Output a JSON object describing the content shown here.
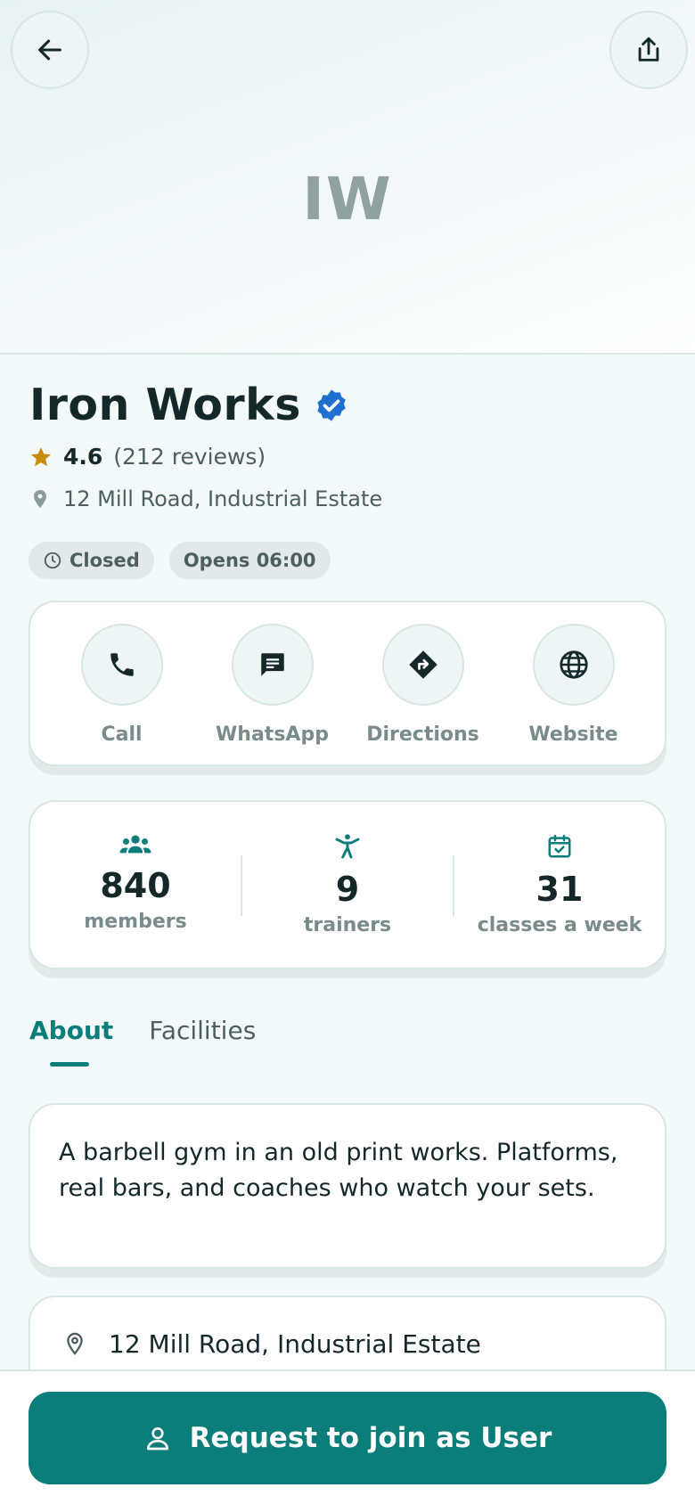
{
  "hero": {
    "initials": "IW"
  },
  "gym": {
    "name": "Iron Works",
    "rating": "4.6",
    "reviews": "(212 reviews)",
    "address": "12 Mill Road, Industrial Estate",
    "status": "Closed",
    "opens": "Opens 06:00"
  },
  "actions": [
    {
      "label": "Call",
      "icon": "phone-icon"
    },
    {
      "label": "WhatsApp",
      "icon": "message-icon"
    },
    {
      "label": "Directions",
      "icon": "directions-icon"
    },
    {
      "label": "Website",
      "icon": "globe-icon"
    }
  ],
  "stats": [
    {
      "value": "840",
      "label": "members",
      "icon": "group-icon"
    },
    {
      "value": "9",
      "label": "trainers",
      "icon": "trainer-icon"
    },
    {
      "value": "31",
      "label": "classes a week",
      "icon": "calendar-check-icon"
    }
  ],
  "tabs": [
    {
      "label": "About",
      "active": true
    },
    {
      "label": "Facilities",
      "active": false
    }
  ],
  "about": {
    "text": "A barbell gym in an old print works. Platforms, real bars, and coaches who watch your sets."
  },
  "location_card": {
    "address": "12 Mill Road, Industrial Estate"
  },
  "cta": {
    "label": "Request to join as User"
  },
  "colors": {
    "accent": "#0b7d7a",
    "star": "#c98a12",
    "verified": "#1f6fd1",
    "background": "#f3f8f8"
  }
}
